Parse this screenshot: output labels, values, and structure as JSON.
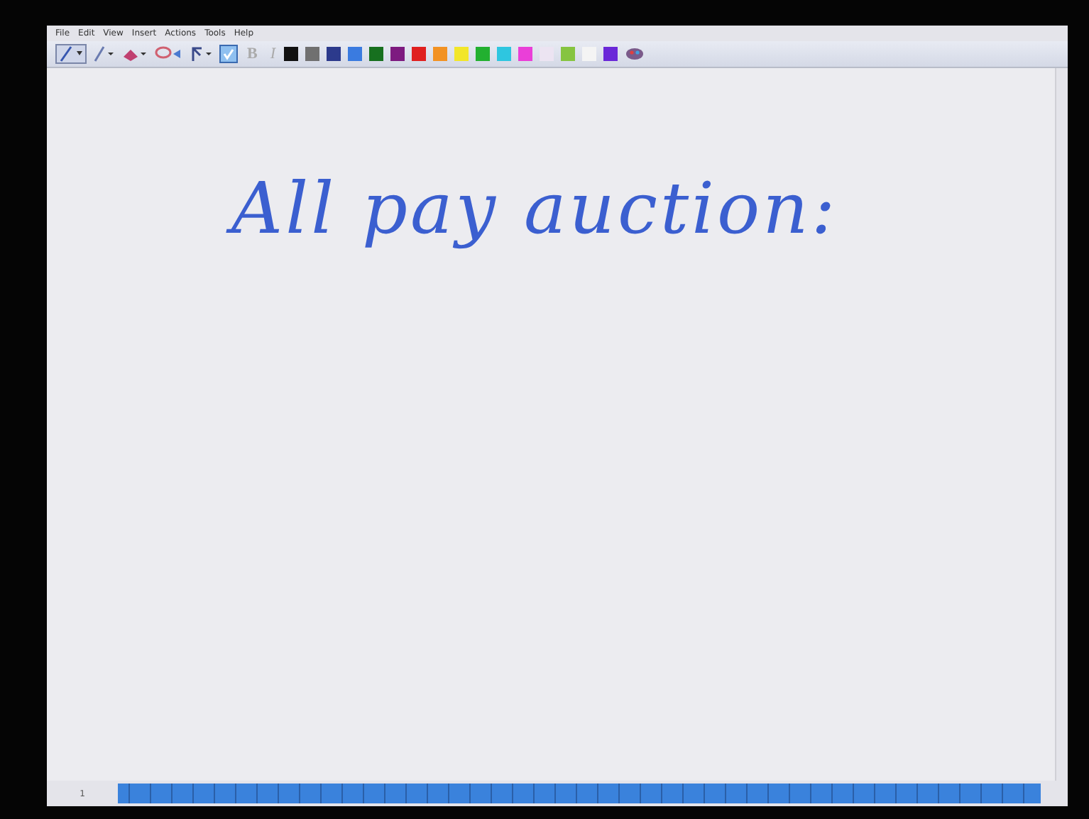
{
  "menu": [
    "File",
    "Edit",
    "View",
    "Insert",
    "Actions",
    "Tools",
    "Help"
  ],
  "toolbar": {
    "bold": "B",
    "italic": "I"
  },
  "swatches": [
    {
      "color": "#111111"
    },
    {
      "color": "#707070"
    },
    {
      "color": "#2c3a8c"
    },
    {
      "color": "#3a7be0"
    },
    {
      "color": "#17701f"
    },
    {
      "color": "#7d1a80"
    },
    {
      "color": "#e02020"
    },
    {
      "color": "#f29224"
    },
    {
      "color": "#f2e62a"
    },
    {
      "color": "#22b030"
    },
    {
      "color": "#2ec6e0"
    },
    {
      "color": "#ea3fd8"
    },
    {
      "color": "#ece4f2"
    },
    {
      "color": "#86c440"
    },
    {
      "color": "#f4f4f4"
    },
    {
      "color": "#6a28d8"
    }
  ],
  "note": {
    "heading": "All pay auction:"
  },
  "status": {
    "page": "1"
  }
}
